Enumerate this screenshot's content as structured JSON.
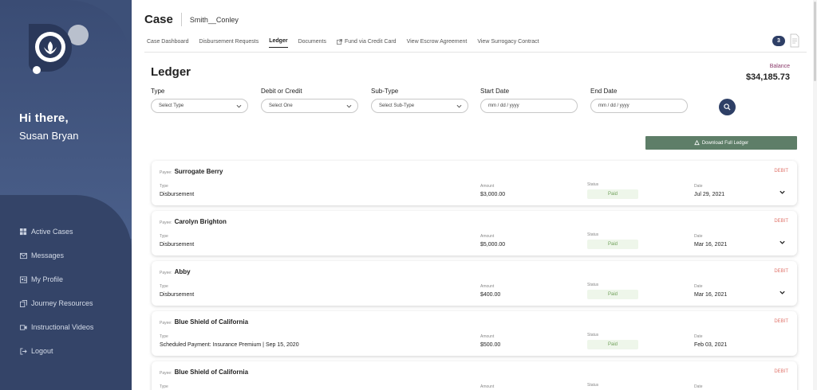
{
  "sidebar": {
    "greeting": "Hi there,",
    "user_name": "Susan Bryan",
    "items": [
      {
        "label": "Active Cases",
        "icon": "grid-icon"
      },
      {
        "label": "Messages",
        "icon": "envelope-icon"
      },
      {
        "label": "My Profile",
        "icon": "profile-card-icon"
      },
      {
        "label": "Journey Resources",
        "icon": "copy-icon"
      },
      {
        "label": "Instructional Videos",
        "icon": "video-icon"
      },
      {
        "label": "Logout",
        "icon": "logout-icon"
      }
    ]
  },
  "header": {
    "title": "Case",
    "case_name": "Smith__Conley",
    "notification_count": "3",
    "tabs": [
      {
        "label": "Case Dashboard"
      },
      {
        "label": "Disbursement Requests"
      },
      {
        "label": "Ledger"
      },
      {
        "label": "Documents"
      },
      {
        "label": "Fund via Credit Card"
      },
      {
        "label": "View Escrow Agreement"
      },
      {
        "label": "View Surrogacy Contract"
      }
    ]
  },
  "ledger": {
    "title": "Ledger",
    "balance_label": "Balance",
    "balance_value": "$34,185.73",
    "download_label": "Download Full Ledger",
    "filters": {
      "type_label": "Type",
      "type_value": "Select Type",
      "debit_label": "Debit or Credit",
      "debit_value": "Select One",
      "subtype_label": "Sub-Type",
      "subtype_value": "Select Sub-Type",
      "start_label": "Start Date",
      "start_placeholder": "mm / dd / yyyy",
      "end_label": "End Date",
      "end_placeholder": "mm / dd / yyyy"
    },
    "labels": {
      "payee": "Payee:",
      "type": "Type",
      "amount": "Amount",
      "status": "Status",
      "date": "Date"
    },
    "entries": [
      {
        "payee": "Surrogate Berry",
        "kind": "DEBIT",
        "type": "Disbursement",
        "amount": "$3,000.00",
        "status": "Paid",
        "date": "Jul 29, 2021"
      },
      {
        "payee": "Carolyn Brighton",
        "kind": "DEBIT",
        "type": "Disbursement",
        "amount": "$5,000.00",
        "status": "Paid",
        "date": "Mar 16, 2021"
      },
      {
        "payee": "Abby",
        "kind": "DEBIT",
        "type": "Disbursement",
        "amount": "$400.00",
        "status": "Paid",
        "date": "Mar 16, 2021"
      },
      {
        "payee": "Blue Shield of California",
        "kind": "DEBIT",
        "type": "Scheduled Payment: Insurance Premium | Sep 15, 2020",
        "amount": "$500.00",
        "status": "Paid",
        "date": "Feb 03, 2021"
      },
      {
        "payee": "Blue Shield of California",
        "kind": "DEBIT",
        "type": "",
        "amount": "",
        "status": "",
        "date": ""
      }
    ]
  },
  "colors": {
    "sidebar": "#3d5078",
    "accent": "#2e3f66",
    "download": "#5e7e68",
    "debit": "#e0736a",
    "paid": "#6fa05a"
  }
}
